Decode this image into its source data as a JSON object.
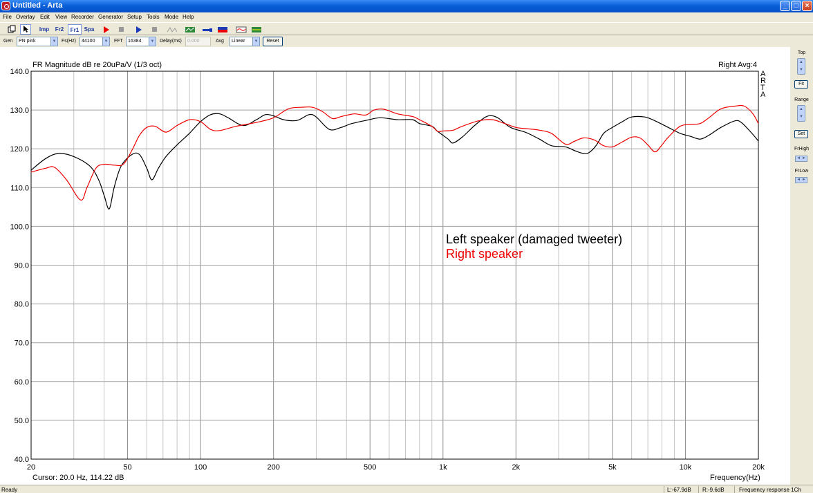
{
  "window": {
    "title": "Untitled - Arta",
    "controls": {
      "minimize": "_",
      "maximize": "□",
      "close": "×"
    }
  },
  "menu": [
    "File",
    "Overlay",
    "Edit",
    "View",
    "Recorder",
    "Generator",
    "Setup",
    "Tools",
    "Mode",
    "Help"
  ],
  "toolbar": {
    "imp": "Imp",
    "fr2": "Fr2",
    "fr1": "Fr1",
    "spa": "Spa"
  },
  "gen_bar": {
    "gen_label": "Gen",
    "gen_value": "PN pink",
    "fs_label": "Fs(Hz)",
    "fs_value": "44100",
    "fft_label": "FFT",
    "fft_value": "16384",
    "delay_label": "Delay(ms)",
    "delay_value": "0.000",
    "avg_label": "Avg",
    "avg_value": "Linear",
    "reset_label": "Reset"
  },
  "plot": {
    "title": "FR Magnitude dB re 20uPa/V (1/3 oct)",
    "status": "Right  Avg:4",
    "arta_vertical": "ARTA",
    "cursor": "Cursor:   20.0 Hz, 114.22 dB",
    "xlabel": "Frequency(Hz)",
    "legend_left": "Left speaker (damaged tweeter)",
    "legend_right": "Right speaker"
  },
  "side_panel": {
    "top": "Top",
    "fit": "Fit",
    "range": "Range",
    "set": "Set",
    "frhigh": "FrHigh",
    "frlow": "FrLow"
  },
  "status_bar": {
    "ready": "Ready",
    "l_level": "L:-67.9dB",
    "r_level": "R:-9.6dB",
    "mode": "Frequency response 1Ch"
  },
  "colors": {
    "left": "#000000",
    "right": "#ee0000",
    "grid": "#a0a0a0"
  },
  "chart_data": {
    "type": "line",
    "title": "FR Magnitude dB re 20uPa/V (1/3 oct)",
    "xlabel": "Frequency(Hz)",
    "ylabel": "",
    "xscale": "log",
    "xlim": [
      20,
      20000
    ],
    "ylim": [
      40,
      140
    ],
    "x_ticks": [
      "20",
      "50",
      "100",
      "200",
      "500",
      "1k",
      "2k",
      "5k",
      "10k",
      "20k"
    ],
    "y_ticks": [
      "40.0",
      "50.0",
      "60.0",
      "70.0",
      "80.0",
      "90.0",
      "100.0",
      "110.0",
      "120.0",
      "130.0",
      "140.0"
    ],
    "grid": true,
    "series": [
      {
        "name": "Left speaker (damaged tweeter)",
        "color": "#000000",
        "points": [
          [
            20,
            114.5
          ],
          [
            23,
            117.5
          ],
          [
            26,
            118.8
          ],
          [
            30,
            118
          ],
          [
            35,
            115.5
          ],
          [
            38,
            112
          ],
          [
            40,
            108
          ],
          [
            42,
            104.5
          ],
          [
            44,
            110
          ],
          [
            47,
            115.5
          ],
          [
            52,
            118.5
          ],
          [
            56,
            118.5
          ],
          [
            60,
            115
          ],
          [
            63,
            112
          ],
          [
            67,
            115
          ],
          [
            72,
            118
          ],
          [
            80,
            121
          ],
          [
            90,
            124
          ],
          [
            100,
            127
          ],
          [
            110,
            128.8
          ],
          [
            120,
            129
          ],
          [
            130,
            128
          ],
          [
            150,
            126
          ],
          [
            170,
            127.5
          ],
          [
            185,
            128.8
          ],
          [
            200,
            128.5
          ],
          [
            220,
            127.5
          ],
          [
            250,
            127.3
          ],
          [
            280,
            128.8
          ],
          [
            300,
            128.2
          ],
          [
            340,
            125
          ],
          [
            380,
            125.5
          ],
          [
            420,
            126.5
          ],
          [
            480,
            127.3
          ],
          [
            550,
            128
          ],
          [
            650,
            127.5
          ],
          [
            750,
            127.5
          ],
          [
            800,
            126.5
          ],
          [
            900,
            125.8
          ],
          [
            950,
            124.5
          ],
          [
            1050,
            122.5
          ],
          [
            1100,
            121.5
          ],
          [
            1200,
            123
          ],
          [
            1350,
            126
          ],
          [
            1500,
            128.2
          ],
          [
            1600,
            128.5
          ],
          [
            1700,
            127.8
          ],
          [
            1900,
            125.5
          ],
          [
            2200,
            124.2
          ],
          [
            2500,
            122.5
          ],
          [
            2800,
            120.8
          ],
          [
            3200,
            120.5
          ],
          [
            3500,
            119.5
          ],
          [
            3800,
            118.8
          ],
          [
            4000,
            119
          ],
          [
            4300,
            121
          ],
          [
            4600,
            124
          ],
          [
            5000,
            125.5
          ],
          [
            5500,
            127
          ],
          [
            6000,
            128.2
          ],
          [
            6800,
            128.2
          ],
          [
            7500,
            127.2
          ],
          [
            8500,
            125.5
          ],
          [
            9500,
            124
          ],
          [
            10500,
            123.2
          ],
          [
            11500,
            122.5
          ],
          [
            12500,
            123.5
          ],
          [
            14000,
            125.5
          ],
          [
            16000,
            127.2
          ],
          [
            17000,
            126.8
          ],
          [
            18500,
            124.5
          ],
          [
            20000,
            122
          ]
        ]
      },
      {
        "name": "Right speaker",
        "color": "#ee0000",
        "points": [
          [
            20,
            114
          ],
          [
            23,
            115
          ],
          [
            25,
            115.2
          ],
          [
            28,
            112
          ],
          [
            32,
            106.8
          ],
          [
            34,
            110
          ],
          [
            37,
            115
          ],
          [
            40,
            116
          ],
          [
            44,
            115.8
          ],
          [
            48,
            116
          ],
          [
            52,
            119.5
          ],
          [
            56,
            123.5
          ],
          [
            60,
            125.5
          ],
          [
            65,
            125.8
          ],
          [
            72,
            124.3
          ],
          [
            80,
            126
          ],
          [
            90,
            127.5
          ],
          [
            100,
            127
          ],
          [
            110,
            125
          ],
          [
            120,
            124.7
          ],
          [
            140,
            125.8
          ],
          [
            170,
            126.8
          ],
          [
            200,
            128
          ],
          [
            230,
            130.3
          ],
          [
            260,
            130.7
          ],
          [
            290,
            130.7
          ],
          [
            320,
            129.5
          ],
          [
            350,
            127.8
          ],
          [
            380,
            128.3
          ],
          [
            430,
            129
          ],
          [
            480,
            128.7
          ],
          [
            520,
            130
          ],
          [
            570,
            130.2
          ],
          [
            650,
            129
          ],
          [
            750,
            128.3
          ],
          [
            800,
            127.5
          ],
          [
            900,
            125.8
          ],
          [
            950,
            124.5
          ],
          [
            1000,
            124.6
          ],
          [
            1100,
            124.8
          ],
          [
            1200,
            125.8
          ],
          [
            1400,
            127.2
          ],
          [
            1600,
            127.5
          ],
          [
            1800,
            126.5
          ],
          [
            2000,
            125.5
          ],
          [
            2200,
            125.2
          ],
          [
            2500,
            124.8
          ],
          [
            2800,
            124
          ],
          [
            3200,
            121.2
          ],
          [
            3500,
            122
          ],
          [
            3800,
            122.8
          ],
          [
            4200,
            122.3
          ],
          [
            4600,
            120.8
          ],
          [
            5000,
            120.5
          ],
          [
            5500,
            121.8
          ],
          [
            6000,
            123
          ],
          [
            6500,
            122.8
          ],
          [
            7000,
            121
          ],
          [
            7500,
            119.2
          ],
          [
            8000,
            121
          ],
          [
            8500,
            123
          ],
          [
            9500,
            125.8
          ],
          [
            10500,
            126.3
          ],
          [
            11500,
            126.5
          ],
          [
            12500,
            128
          ],
          [
            14000,
            130.3
          ],
          [
            16000,
            131
          ],
          [
            17500,
            131
          ],
          [
            19000,
            129
          ],
          [
            20000,
            126.5
          ]
        ]
      }
    ]
  }
}
